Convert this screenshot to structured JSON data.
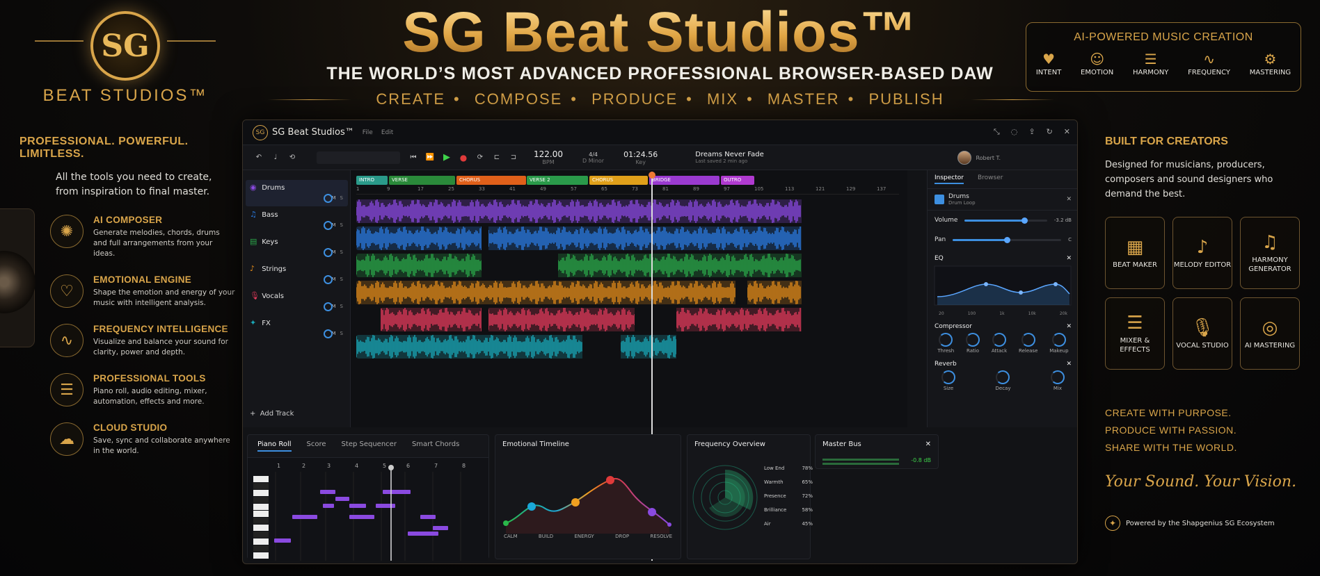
{
  "header": {
    "title": "SG Beat Studios™",
    "subtitle": "THE WORLD’S MOST ADVANCED PROFESSIONAL BROWSER-BASED DAW",
    "taglines": [
      "CREATE",
      "COMPOSE",
      "PRODUCE",
      "MIX",
      "MASTER",
      "PUBLISH"
    ],
    "logo_monogram": "SG",
    "logo_text": "BEAT STUDIOS™"
  },
  "ai_panel": {
    "title": "AI-POWERED MUSIC CREATION",
    "items": [
      {
        "label": "INTENT",
        "icon": "heart-brain-icon"
      },
      {
        "label": "EMOTION",
        "icon": "smile-icon"
      },
      {
        "label": "HARMONY",
        "icon": "sliders-icon"
      },
      {
        "label": "FREQUENCY",
        "icon": "waveform-icon"
      },
      {
        "label": "MASTERING",
        "icon": "gear-icon"
      }
    ]
  },
  "left": {
    "heading": "PROFESSIONAL. POWERFUL. LIMITLESS.",
    "intro": "All the tools you need to create, from inspiration to final master.",
    "features": [
      {
        "title": "AI COMPOSER",
        "desc": "Generate melodies, chords, drums and full arrangements from your ideas.",
        "icon": "brain-icon"
      },
      {
        "title": "EMOTIONAL ENGINE",
        "desc": "Shape the emotion and energy of your music with intelligent analysis.",
        "icon": "heart-icon"
      },
      {
        "title": "FREQUENCY INTELLIGENCE",
        "desc": "Visualize and balance your sound for clarity, power and depth.",
        "icon": "waveform-icon"
      },
      {
        "title": "PROFESSIONAL TOOLS",
        "desc": "Piano roll, audio editing, mixer, automation, effects and more.",
        "icon": "sliders-icon"
      },
      {
        "title": "CLOUD STUDIO",
        "desc": "Save, sync and collaborate anywhere in the world.",
        "icon": "cloud-icon"
      }
    ]
  },
  "right": {
    "heading": "BUILT FOR CREATORS",
    "intro": "Designed for musicians, producers, composers and sound designers who demand the best.",
    "tools": [
      {
        "label": "BEAT MAKER",
        "icon": "beat-maker-icon"
      },
      {
        "label": "MELODY EDITOR",
        "icon": "music-note-icon"
      },
      {
        "label": "HARMONY GENERATOR",
        "icon": "music-notes-icon"
      },
      {
        "label": "MIXER & EFFECTS",
        "icon": "sliders-icon"
      },
      {
        "label": "VOCAL STUDIO",
        "icon": "microphone-icon"
      },
      {
        "label": "AI MASTERING",
        "icon": "ai-mastering-icon"
      }
    ],
    "slogan": [
      "CREATE WITH PURPOSE.",
      "PRODUCE WITH PASSION.",
      "SHARE WITH THE WORLD."
    ],
    "script": "Your Sound. Your Vision.",
    "powered": "Powered by the Shapgenius SG Ecosystem"
  },
  "daw": {
    "app_title": "SG Beat Studios™",
    "menu": [
      "File",
      "Edit"
    ],
    "transport": {
      "tempo": "122.00",
      "tempo_label": "BPM",
      "time_sig": "4/4",
      "key": "D Minor",
      "position": "01:24.56",
      "position_label": "Key",
      "song_name": "Dreams Never Fade",
      "saved": "Last saved 2 min ago",
      "user": "Robert T."
    },
    "tracks": [
      {
        "name": "Drums",
        "color": "#8a4ae0"
      },
      {
        "name": "Bass",
        "color": "#2a7ae0"
      },
      {
        "name": "Keys",
        "color": "#2aa84a"
      },
      {
        "name": "Strings",
        "color": "#e08a1a"
      },
      {
        "name": "Vocals",
        "color": "#e03a5a"
      },
      {
        "name": "FX",
        "color": "#1aa8b8"
      }
    ],
    "add_track": "Add Track",
    "track_controls": {
      "mute": "M",
      "solo": "S"
    },
    "sections": [
      {
        "name": "INTRO",
        "color": "#2a9a8a"
      },
      {
        "name": "VERSE",
        "color": "#2a8a3a"
      },
      {
        "name": "CHORUS",
        "color": "#e0601a"
      },
      {
        "name": "VERSE 2",
        "color": "#2a9a4a"
      },
      {
        "name": "CHORUS",
        "color": "#e0a01a"
      },
      {
        "name": "BRIDGE",
        "color": "#9a3ad0"
      },
      {
        "name": "OUTRO",
        "color": "#b03ad0"
      }
    ],
    "ruler": [
      "1",
      "9",
      "17",
      "25",
      "33",
      "41",
      "49",
      "57",
      "65",
      "73",
      "81",
      "89",
      "97",
      "105",
      "113",
      "121",
      "129",
      "137"
    ],
    "inspector": {
      "tabs": [
        "Inspector",
        "Browser"
      ],
      "track": "Drums",
      "track_sub": "Drum Loop",
      "volume_label": "Volume",
      "volume_value": "-3.2 dB",
      "volume_level": 0.72,
      "pan_label": "Pan",
      "pan_value": "C",
      "pan_level": 0.5,
      "eq_label": "EQ",
      "eq_axis": [
        "20",
        "100",
        "1k",
        "10k",
        "20k"
      ],
      "compressor_label": "Compressor",
      "compressor_knobs": [
        "Thresh",
        "Ratio",
        "Attack",
        "Release",
        "Makeup"
      ],
      "reverb_label": "Reverb",
      "reverb_knobs": [
        "Size",
        "Decay",
        "Mix"
      ]
    },
    "bottom": {
      "piano_tabs": [
        "Piano Roll",
        "Score",
        "Step Sequencer",
        "Smart Chords"
      ],
      "piano_bars": [
        "1",
        "2",
        "3",
        "4",
        "5",
        "6",
        "7",
        "8"
      ],
      "emotional_title": "Emotional Timeline",
      "emotional_labels": [
        "CALM",
        "BUILD",
        "ENERGY",
        "DROP",
        "RESOLVE"
      ],
      "frequency_title": "Frequency Overview",
      "frequency_bands": [
        {
          "name": "Low End",
          "value": "78%"
        },
        {
          "name": "Warmth",
          "value": "65%"
        },
        {
          "name": "Presence",
          "value": "72%"
        },
        {
          "name": "Brilliance",
          "value": "58%"
        },
        {
          "name": "Air",
          "value": "45%"
        }
      ],
      "master_title": "Master Bus",
      "master_value": "-0.8 dB"
    }
  }
}
